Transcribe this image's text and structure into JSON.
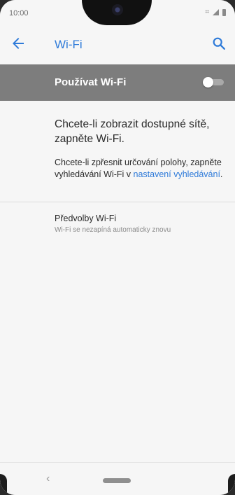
{
  "status_bar": {
    "time": "10:00"
  },
  "toolbar": {
    "title": "Wi-Fi"
  },
  "wifi_master": {
    "label": "Používat Wi-Fi",
    "enabled": false
  },
  "main": {
    "heading": "Chcete-li zobrazit dostupné sítě, zapněte Wi-Fi.",
    "hint_prefix": "Chcete-li zpřesnit určování polohy, zapněte vyhledávání Wi-Fi v ",
    "hint_link": "nastavení vyhledávání",
    "hint_suffix": "."
  },
  "preferences": {
    "title": "Předvolby Wi-Fi",
    "subtitle": "Wi-Fi se nezapíná automaticky znovu"
  },
  "icons": {
    "back": "arrow-left-icon",
    "search": "search-icon",
    "signal": "signal-icon",
    "battery": "battery-icon",
    "nav_back": "chevron-left-icon",
    "nav_home": "home-pill-icon"
  },
  "colors": {
    "accent": "#2f7bd9",
    "bar": "#7d7d7d"
  }
}
